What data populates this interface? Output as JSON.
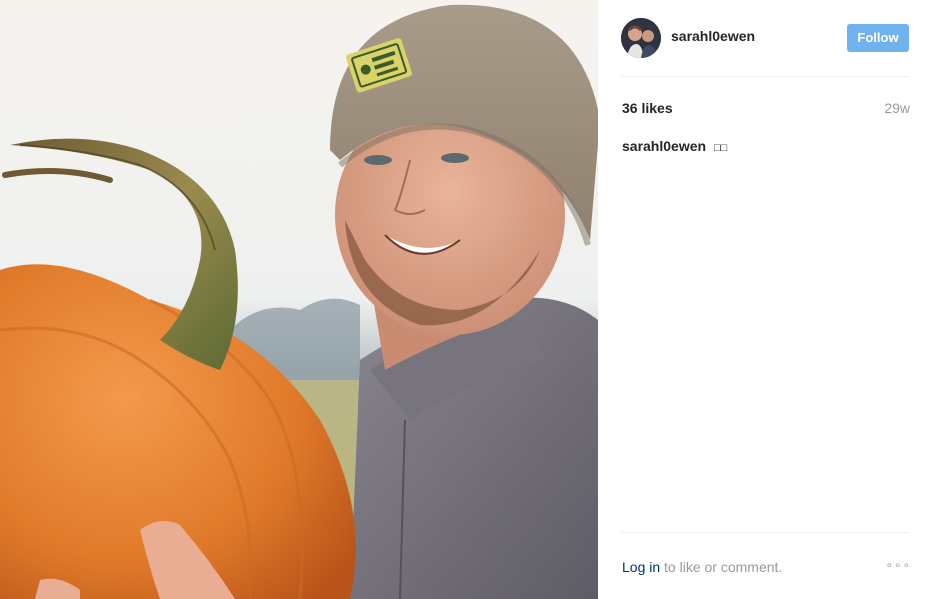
{
  "post": {
    "username": "sarahl0ewen",
    "follow_label": "Follow",
    "likes": "36 likes",
    "timestamp": "29w",
    "caption_user": "sarahl0ewen",
    "caption_text": "□□",
    "login_link": "Log in",
    "login_suffix": " to like or comment.",
    "more_label": "∘∘∘"
  },
  "colors": {
    "follow_button": "#70b2ee",
    "link": "#003569",
    "muted": "#999999",
    "text": "#262626"
  },
  "icons": {
    "more": "ellipsis-icon"
  }
}
